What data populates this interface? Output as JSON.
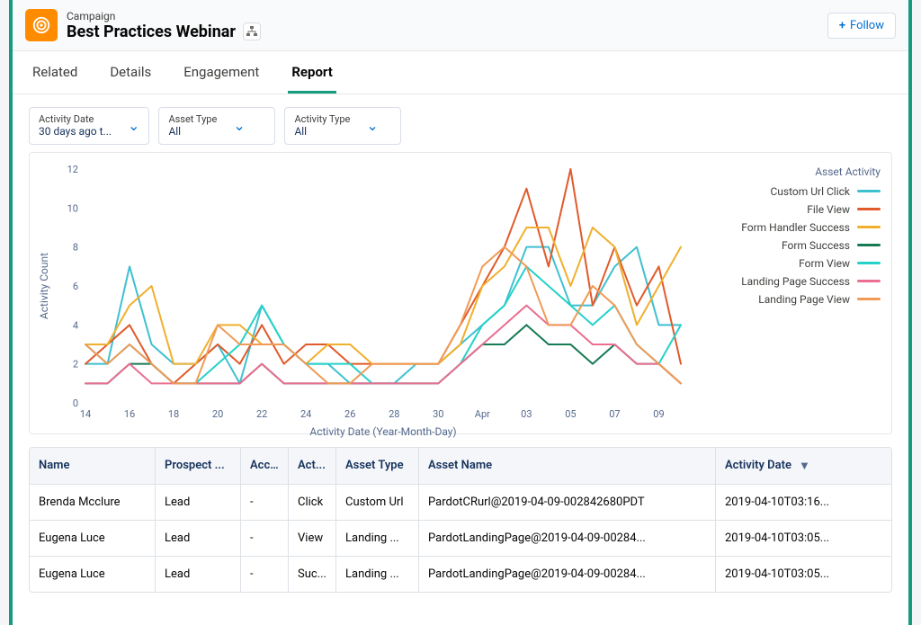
{
  "header": {
    "record_type": "Campaign",
    "record_name": "Best Practices Webinar",
    "follow_label": "Follow",
    "follow_plus": "+"
  },
  "tabs": [
    {
      "id": "related",
      "label": "Related",
      "active": false
    },
    {
      "id": "details",
      "label": "Details",
      "active": false
    },
    {
      "id": "engagement",
      "label": "Engagement",
      "active": false
    },
    {
      "id": "report",
      "label": "Report",
      "active": true
    }
  ],
  "filters": [
    {
      "label": "Activity Date",
      "value": "30 days ago t..."
    },
    {
      "label": "Asset Type",
      "value": "All"
    },
    {
      "label": "Activity Type",
      "value": "All"
    }
  ],
  "legend_title": "Asset Activity",
  "chart_data": {
    "type": "line",
    "title": "",
    "xlabel": "Activity Date (Year-Month-Day)",
    "ylabel": "Activity Count",
    "ylim": [
      0,
      12
    ],
    "categories": [
      "14",
      "16",
      "18",
      "20",
      "22",
      "24",
      "26",
      "28",
      "30",
      "Apr",
      "03",
      "05",
      "07",
      "09"
    ],
    "x": [
      14,
      15,
      16,
      17,
      18,
      19,
      20,
      21,
      22,
      23,
      24,
      25,
      26,
      27,
      28,
      29,
      30,
      31,
      1,
      2,
      3,
      4,
      5,
      6,
      7,
      8,
      9,
      10
    ],
    "series": [
      {
        "name": "Custom Url Click",
        "color": "#3fc0d0",
        "values": [
          2,
          2,
          7,
          3,
          2,
          2,
          3,
          1,
          5,
          3,
          2,
          2,
          1,
          1,
          1,
          2,
          2,
          3,
          4,
          5,
          8,
          8,
          5,
          5,
          7,
          8,
          4,
          4
        ]
      },
      {
        "name": "File View",
        "color": "#e05a2b",
        "values": [
          2,
          3,
          4,
          2,
          1,
          2,
          3,
          2,
          4,
          2,
          3,
          3,
          2,
          2,
          2,
          2,
          2,
          4,
          6,
          8,
          11,
          7,
          12,
          5,
          8,
          5,
          7,
          2
        ]
      },
      {
        "name": "Form Handler Success",
        "color": "#f0b02e",
        "values": [
          3,
          3,
          5,
          6,
          2,
          2,
          4,
          4,
          3,
          3,
          2,
          3,
          3,
          2,
          2,
          2,
          2,
          3,
          6,
          7,
          9,
          9,
          6,
          9,
          8,
          4,
          6,
          8
        ]
      },
      {
        "name": "Form Success",
        "color": "#167a53",
        "values": [
          1,
          1,
          2,
          2,
          1,
          1,
          1,
          1,
          2,
          1,
          1,
          1,
          1,
          1,
          1,
          1,
          1,
          2,
          3,
          3,
          4,
          3,
          3,
          2,
          3,
          2,
          2,
          1
        ]
      },
      {
        "name": "Form View",
        "color": "#25d1c9",
        "values": [
          3,
          2,
          3,
          2,
          1,
          1,
          2,
          3,
          5,
          3,
          2,
          2,
          2,
          1,
          1,
          1,
          1,
          2,
          4,
          5,
          7,
          6,
          5,
          4,
          5,
          3,
          2,
          4
        ]
      },
      {
        "name": "Landing Page Success",
        "color": "#ea6e90",
        "values": [
          1,
          1,
          2,
          1,
          1,
          1,
          1,
          1,
          2,
          1,
          1,
          1,
          1,
          1,
          1,
          1,
          1,
          2,
          3,
          4,
          5,
          4,
          4,
          3,
          3,
          2,
          2,
          1
        ]
      },
      {
        "name": "Landing Page View",
        "color": "#f09a56",
        "values": [
          3,
          2,
          3,
          2,
          1,
          1,
          4,
          3,
          3,
          3,
          2,
          1,
          1,
          2,
          2,
          2,
          2,
          4,
          7,
          8,
          7,
          4,
          4,
          6,
          5,
          3,
          2,
          1
        ]
      }
    ]
  },
  "table": {
    "columns": [
      {
        "key": "name",
        "label": "Name"
      },
      {
        "key": "prospect",
        "label": "Prospect ..."
      },
      {
        "key": "acc",
        "label": "Acc..."
      },
      {
        "key": "act",
        "label": "Act..."
      },
      {
        "key": "asset_type",
        "label": "Asset Type"
      },
      {
        "key": "asset_name",
        "label": "Asset Name"
      },
      {
        "key": "date",
        "label": "Activity Date"
      }
    ],
    "rows": [
      {
        "name": "Brenda Mcclure",
        "prospect": "Lead",
        "acc": "-",
        "act": "Click",
        "asset_type": "Custom Url",
        "asset_name": "PardotCRurl@2019-04-09-002842680PDT",
        "date": "2019-04-10T03:16..."
      },
      {
        "name": "Eugena Luce",
        "prospect": "Lead",
        "acc": "-",
        "act": "View",
        "asset_type": "Landing ...",
        "asset_name": "PardotLandingPage@2019-04-09-00284...",
        "date": "2019-04-10T03:05..."
      },
      {
        "name": "Eugena Luce",
        "prospect": "Lead",
        "acc": "-",
        "act": "Suc...",
        "asset_type": "Landing ...",
        "asset_name": "PardotLandingPage@2019-04-09-00284...",
        "date": "2019-04-10T03:05..."
      }
    ]
  }
}
